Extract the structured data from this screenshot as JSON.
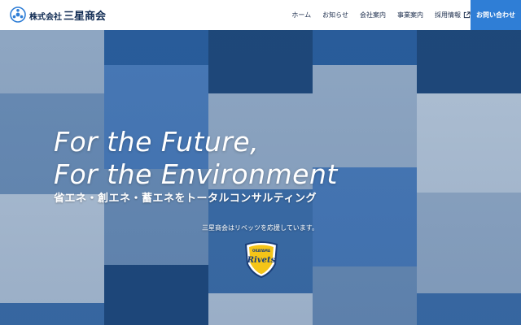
{
  "header": {
    "logo": {
      "prefix": "株式会社",
      "name": "三星商会"
    },
    "nav": [
      {
        "label": "ホーム"
      },
      {
        "label": "お知らせ"
      },
      {
        "label": "会社案内"
      },
      {
        "label": "事業案内"
      },
      {
        "label": "採用情報",
        "icon": "external-link-icon"
      }
    ],
    "contact_label": "お問い合わせ"
  },
  "hero": {
    "title_line1": "For the Future,",
    "title_line2": "For the Environment",
    "subtitle": "省エネ・創エネ・蓄エネをトータルコンサルティング",
    "sponsor_text": "三星商会はリベッツを応援しています。",
    "sponsor_logo": {
      "top": "OKAYAMA",
      "name": "Rivets"
    }
  },
  "colors": {
    "brand_navy": "#0f2a52",
    "contact_blue": "#2f7ed6",
    "tile_blue": "#2a5e9c"
  }
}
